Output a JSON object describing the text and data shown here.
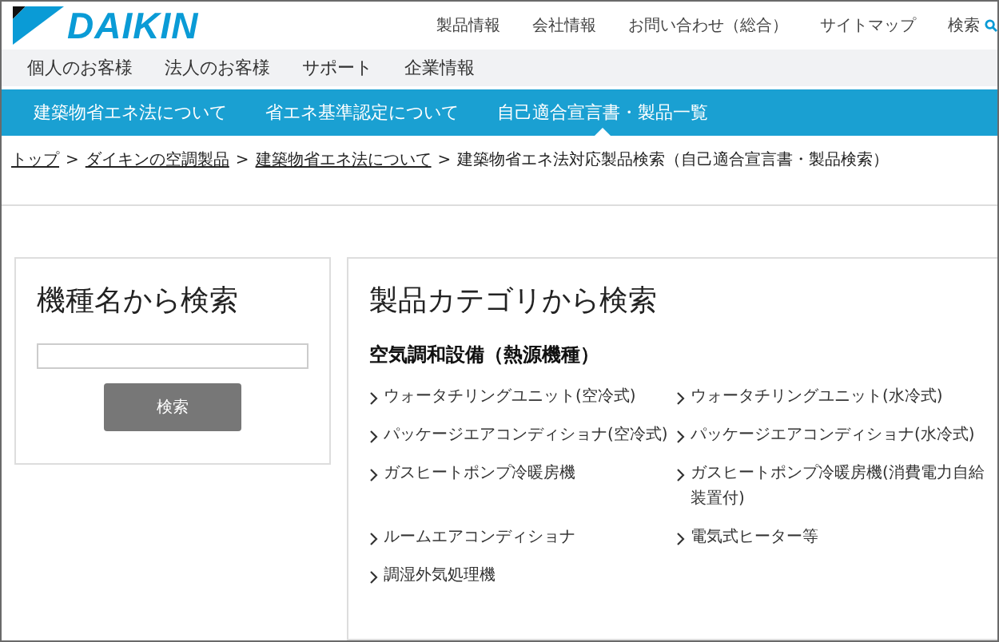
{
  "logo": {
    "text": "DAIKIN"
  },
  "utility_nav": [
    {
      "label": "製品情報"
    },
    {
      "label": "会社情報"
    },
    {
      "label": "お問い合わせ（総合）"
    },
    {
      "label": "サイトマップ"
    },
    {
      "label": "検索",
      "kind": "search"
    }
  ],
  "main_nav": [
    {
      "label": "個人のお客様"
    },
    {
      "label": "法人のお客様"
    },
    {
      "label": "サポート"
    },
    {
      "label": "企業情報"
    }
  ],
  "sub_nav": [
    {
      "label": "建築物省エネ法について",
      "selected": false
    },
    {
      "label": "省エネ基準認定について",
      "selected": false
    },
    {
      "label": "自己適合宣言書・製品一覧",
      "selected": true
    }
  ],
  "breadcrumb_separator": ">",
  "breadcrumb": [
    {
      "label": "トップ",
      "link": true
    },
    {
      "label": "ダイキンの空調製品",
      "link": true
    },
    {
      "label": "建築物省エネ法について",
      "link": true
    },
    {
      "label": "建築物省エネ法対応製品検索（自己適合宣言書・製品検索）",
      "link": false
    }
  ],
  "model_search": {
    "title": "機種名から検索",
    "button": "検索"
  },
  "category_search": {
    "title": "製品カテゴリから検索",
    "section": "空気調和設備（熱源機種）",
    "items": [
      {
        "label": "ウォータチリングユニット(空冷式)"
      },
      {
        "label": "ウォータチリングユニット(水冷式)"
      },
      {
        "label": "パッケージエアコンディショナ(空冷式)"
      },
      {
        "label": "パッケージエアコンディショナ(水冷式)"
      },
      {
        "label": "ガスヒートポンプ冷暖房機"
      },
      {
        "label": "ガスヒートポンプ冷暖房機(消費電力自給装置付)"
      },
      {
        "label": "ルームエアコンディショナ"
      },
      {
        "label": "電気式ヒーター等"
      },
      {
        "label": "調湿外気処理機"
      }
    ]
  }
}
